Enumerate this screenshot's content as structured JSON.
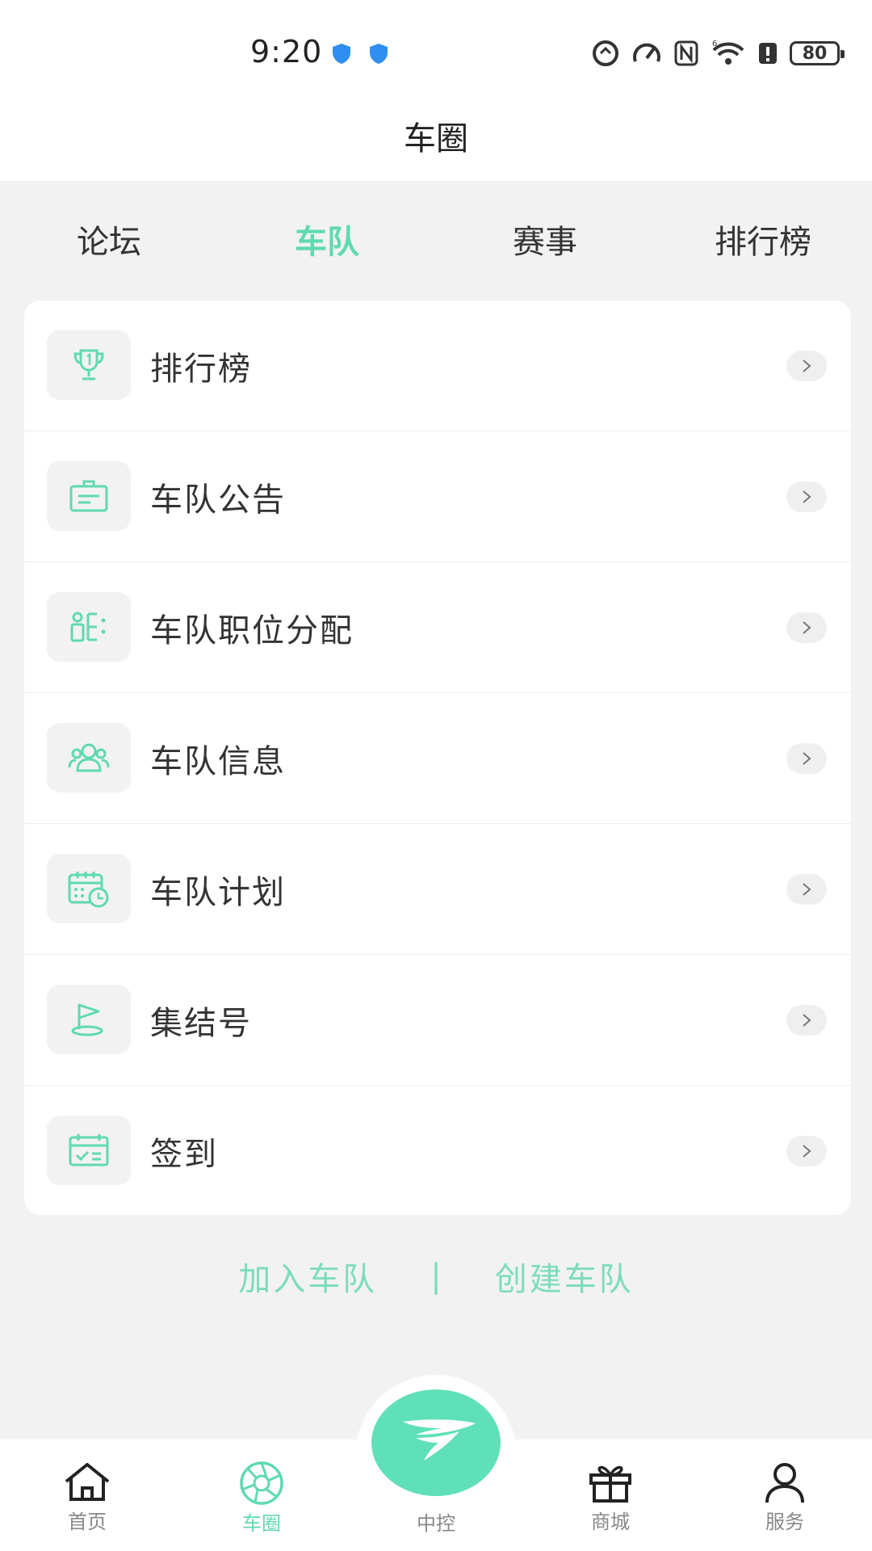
{
  "status_bar": {
    "time": "9:20",
    "battery": "80",
    "icons": [
      "shield-icon",
      "shield-icon",
      "data-saver-icon",
      "speedometer-icon",
      "nfc-icon",
      "wifi-icon",
      "alert-icon",
      "battery-icon"
    ]
  },
  "header": {
    "title": "车圈"
  },
  "tabs": [
    {
      "label": "论坛"
    },
    {
      "label": "车队"
    },
    {
      "label": "赛事"
    },
    {
      "label": "排行榜"
    }
  ],
  "active_tab_index": 1,
  "menu": {
    "items": [
      {
        "label": "排行榜",
        "icon": "trophy-icon"
      },
      {
        "label": "车队公告",
        "icon": "announcement-board-icon"
      },
      {
        "label": "车队职位分配",
        "icon": "position-assign-icon"
      },
      {
        "label": "车队信息",
        "icon": "team-members-icon"
      },
      {
        "label": "车队计划",
        "icon": "calendar-clock-icon"
      },
      {
        "label": "集结号",
        "icon": "flag-icon"
      },
      {
        "label": "签到",
        "icon": "checkin-calendar-icon"
      }
    ]
  },
  "actions": {
    "join": "加入车队",
    "separator": "|",
    "create": "创建车队"
  },
  "tabbar": {
    "items": [
      {
        "label": "首页",
        "icon": "home-icon"
      },
      {
        "label": "车圈",
        "icon": "aperture-icon"
      },
      {
        "label": "中控",
        "icon": "wing-logo-icon"
      },
      {
        "label": "商城",
        "icon": "gift-icon"
      },
      {
        "label": "服务",
        "icon": "person-icon"
      }
    ],
    "active_index": 1
  },
  "colors": {
    "accent": "#5fd9b2",
    "accent_light": "#7ddcbd",
    "background": "#f2f2f2",
    "card": "#ffffff"
  }
}
